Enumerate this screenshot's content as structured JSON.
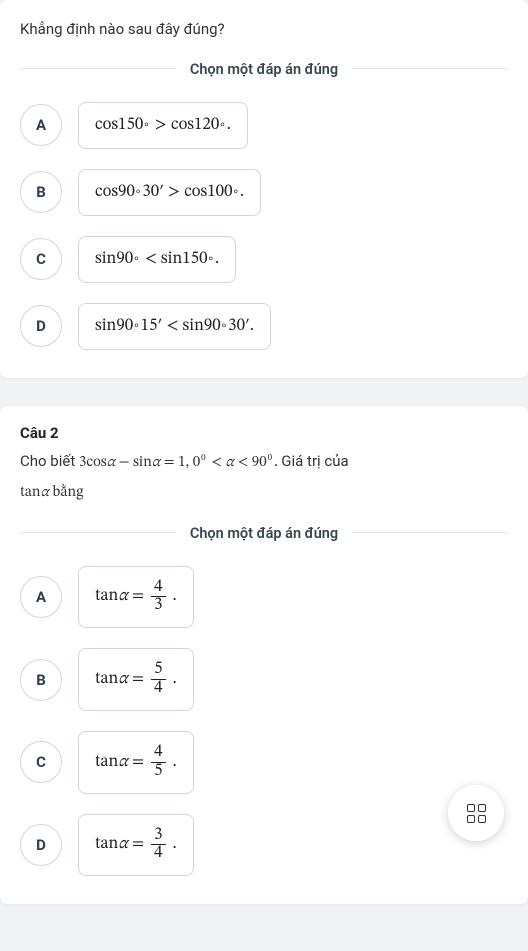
{
  "card1": {
    "question": "Khẳng định nào sau đây đúng?",
    "divider": "Chọn một đáp án đúng",
    "opts": {
      "A": {
        "letter": "A",
        "p1": "cos150",
        "cmp": ">",
        "p2": "cos120",
        "tail": " ."
      },
      "B": {
        "letter": "B",
        "p1": "cos90",
        "m1": "30",
        "cmp": ">",
        "p2": "cos100",
        "tail": " ."
      },
      "C": {
        "letter": "C",
        "p1": "sin90",
        "cmp": "<",
        "p2": "sin150",
        "tail": " ."
      },
      "D": {
        "letter": "D",
        "p1": "sin90",
        "m1": "15",
        "cmp": "<",
        "p2": "sin90",
        "m2": "30",
        "tail": " ."
      }
    }
  },
  "card2": {
    "qnum": "Câu 2",
    "question_pre": "Cho biết ",
    "expr1": "3cos",
    "alpha": "α",
    "minus": " − ",
    "expr2": "sin",
    "eq": " = 1, 0",
    "ltsym": " < ",
    "ltend": " < 90",
    "period": ". ",
    "tail": "Giá trị của ",
    "line2a": "tan",
    "line2b": " bằng",
    "divider": "Chọn một đáp án đúng",
    "opts": {
      "A": {
        "letter": "A",
        "lhs": "tan",
        "num": "4",
        "den": "3"
      },
      "B": {
        "letter": "B",
        "lhs": "tan",
        "num": "5",
        "den": "4"
      },
      "C": {
        "letter": "C",
        "lhs": "tan",
        "num": "4",
        "den": "5"
      },
      "D": {
        "letter": "D",
        "lhs": "tan",
        "num": "3",
        "den": "4"
      }
    }
  },
  "sym": {
    "deg": "∘",
    "prime": "′",
    "alpha": "α",
    "zero": "0"
  }
}
